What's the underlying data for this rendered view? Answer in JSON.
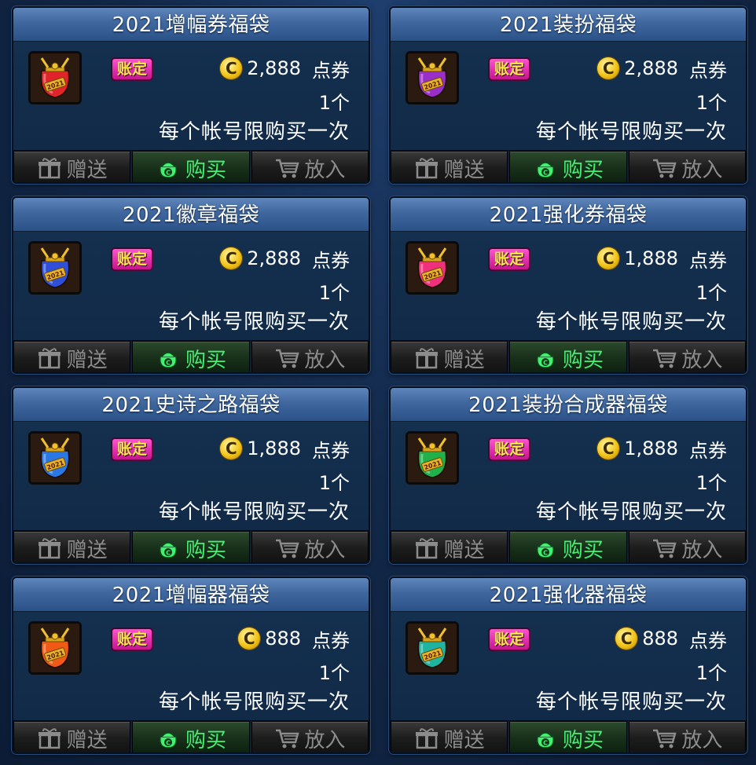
{
  "colors": {
    "accent_buy": "#43f072",
    "badge": "#e030a8",
    "title_bar": "#3f679e"
  },
  "cards": [
    {
      "title": "2021增幅券福袋",
      "badge": "账定",
      "price": "2,888",
      "unit": "点券",
      "qty": "1个",
      "limit": "每个帐号限购买一次",
      "bag_color": "#e0242a",
      "gift": "赠送",
      "buy": "购买",
      "cart": "放入"
    },
    {
      "title": "2021装扮福袋",
      "badge": "账定",
      "price": "2,888",
      "unit": "点券",
      "qty": "1个",
      "limit": "每个帐号限购买一次",
      "bag_color": "#9a2ec8",
      "gift": "赠送",
      "buy": "购买",
      "cart": "放入"
    },
    {
      "title": "2021徽章福袋",
      "badge": "账定",
      "price": "2,888",
      "unit": "点券",
      "qty": "1个",
      "limit": "每个帐号限购买一次",
      "bag_color": "#2f4fd8",
      "gift": "赠送",
      "buy": "购买",
      "cart": "放入"
    },
    {
      "title": "2021强化券福袋",
      "badge": "账定",
      "price": "1,888",
      "unit": "点券",
      "qty": "1个",
      "limit": "每个帐号限购买一次",
      "bag_color": "#f0307a",
      "gift": "赠送",
      "buy": "购买",
      "cart": "放入"
    },
    {
      "title": "2021史诗之路福袋",
      "badge": "账定",
      "price": "1,888",
      "unit": "点券",
      "qty": "1个",
      "limit": "每个帐号限购买一次",
      "bag_color": "#2a78e6",
      "gift": "赠送",
      "buy": "购买",
      "cart": "放入"
    },
    {
      "title": "2021装扮合成器福袋",
      "badge": "账定",
      "price": "1,888",
      "unit": "点券",
      "qty": "1个",
      "limit": "每个帐号限购买一次",
      "bag_color": "#21b04a",
      "gift": "赠送",
      "buy": "购买",
      "cart": "放入"
    },
    {
      "title": "2021增幅器福袋",
      "badge": "账定",
      "price": "888",
      "unit": "点券",
      "qty": "1个",
      "limit": "每个帐号限购买一次",
      "bag_color": "#f05a16",
      "gift": "赠送",
      "buy": "购买",
      "cart": "放入"
    },
    {
      "title": "2021强化器福袋",
      "badge": "账定",
      "price": "888",
      "unit": "点券",
      "qty": "1个",
      "limit": "每个帐号限购买一次",
      "bag_color": "#1fb3a0",
      "gift": "赠送",
      "buy": "购买",
      "cart": "放入"
    }
  ]
}
